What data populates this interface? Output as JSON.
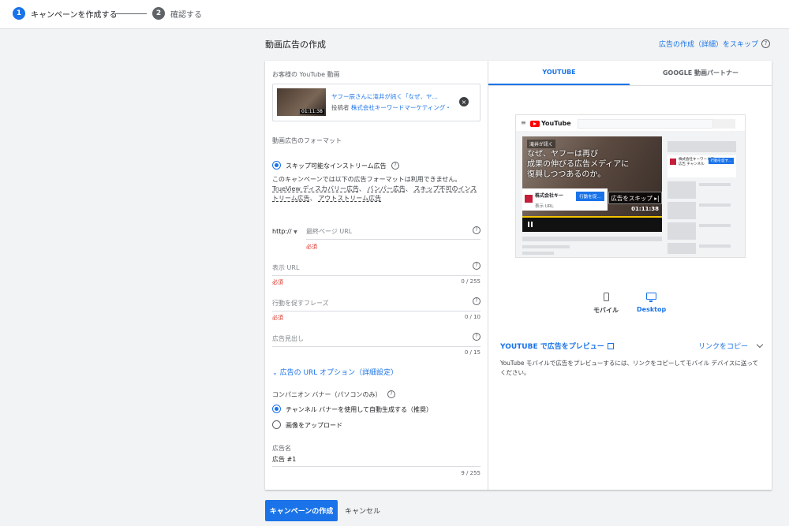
{
  "steps": [
    {
      "num": "1",
      "label": "キャンペーンを作成する"
    },
    {
      "num": "2",
      "label": "確認する"
    }
  ],
  "page": {
    "title": "動画広告の作成",
    "skip_link": "広告の作成（詳細）をスキップ"
  },
  "video": {
    "section_label": "お客様の YouTube 動画",
    "title": "ヤフー辰さんに滝井が訊く「なぜ、ヤ…",
    "by_label": "投稿者",
    "channel": "株式会社キーワードマーケティング・",
    "duration": "01:11:38"
  },
  "format": {
    "label": "動画広告のフォーマット",
    "selected": "スキップ可能なインストリーム広告",
    "desc_prefix": "このキャンペーンでは以下の広告フォーマットは利用できません。",
    "fmt1": "TrueView ディスカバリー広告",
    "fmt2": "バンパー広告",
    "fmt3": "スキップ不可のインストリーム広告",
    "fmt4": "アウトストリーム広告"
  },
  "fields": {
    "protocol": "http://",
    "final_url_placeholder": "最終ページ URL",
    "final_url_error": "必須",
    "display_url_placeholder": "表示 URL",
    "display_url_error": "必須",
    "display_url_count": "0 / 255",
    "cta_placeholder": "行動を促すフレーズ",
    "cta_error": "必須",
    "cta_count": "0 / 10",
    "headline_placeholder": "広告見出し",
    "headline_count": "0 / 15"
  },
  "url_options": "広告の URL オプション（詳細設定）",
  "banner": {
    "label": "コンパニオン バナー（パソコンのみ）",
    "option1": "チャンネル バナーを使用して自動生成する（推奨）",
    "option2": "画像をアップロード"
  },
  "ad_name": {
    "label": "広告名",
    "value": "広告 #1",
    "count": "9 / 255"
  },
  "tabs": [
    {
      "label": "YOUTUBE"
    },
    {
      "label": "GOOGLE 動画パートナー"
    }
  ],
  "preview": {
    "logo": "YouTube",
    "tag": "滝井が訊く",
    "overlay_line1": "なぜ、ヤフーは再び",
    "overlay_line2": "成果の伸びる広告メディアに",
    "overlay_line3": "復興しつつあるのか。",
    "ad_channel": "株式会社キー",
    "ad_url": "表示 URL",
    "cta": "行動を促…",
    "skip": "広告をスキップ",
    "duration": "01:11:38",
    "side_channel_line1": "株式会社キーワードマー",
    "side_channel_line2": "広告 チャンネル",
    "side_cta": "行動を促す..."
  },
  "devices": {
    "mobile": "モバイル",
    "desktop": "Desktop"
  },
  "share": {
    "preview_on_youtube": "YOUTUBE で広告をプレビュー",
    "copy_link": "リンクをコピー",
    "note": "YouTube モバイルで広告をプレビューするには、リンクをコピーしてモバイル デバイスに送ってください。"
  },
  "footer": {
    "create": "キャンペーンの作成",
    "cancel": "キャンセル"
  },
  "colors": {
    "accent": "#1a73e8",
    "error": "#d93025",
    "youtube_red": "#ff0000"
  }
}
